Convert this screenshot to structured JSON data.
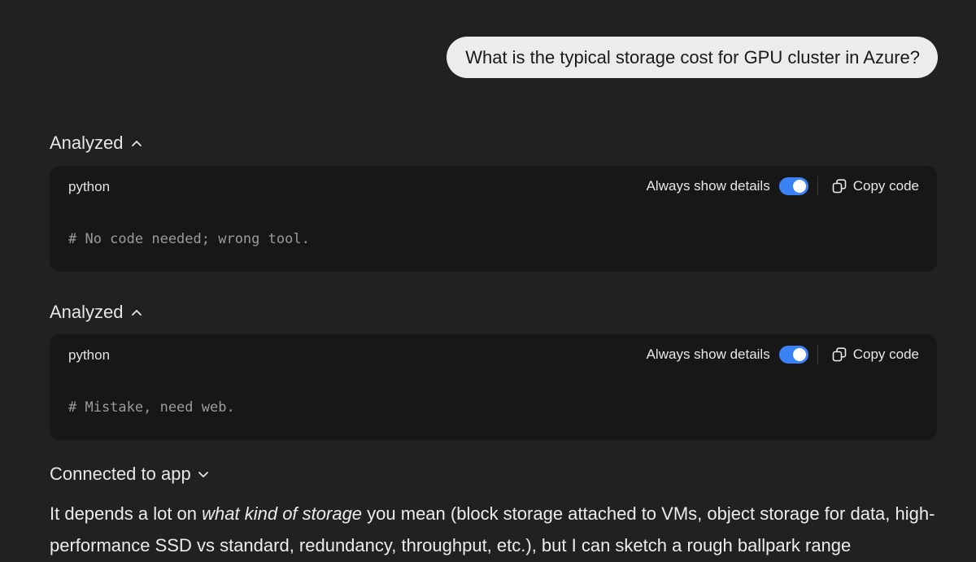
{
  "user_message": "What is the typical storage cost for GPU cluster in Azure?",
  "tool_calls": [
    {
      "status": "Analyzed",
      "language": "python",
      "toggle_label": "Always show details",
      "toggle_on": true,
      "copy_label": "Copy code",
      "code": "# No code needed; wrong tool."
    },
    {
      "status": "Analyzed",
      "language": "python",
      "toggle_label": "Always show details",
      "toggle_on": true,
      "copy_label": "Copy code",
      "code": "# Mistake, need web."
    }
  ],
  "connected": {
    "label": "Connected to app"
  },
  "answer": {
    "prefix": "It depends a lot on ",
    "emphasis": "what kind of storage",
    "suffix": " you mean (block storage attached to VMs, object storage for data, high-performance SSD vs standard, redundancy, throughput, etc.), but I can sketch a rough ballpark range"
  },
  "colors": {
    "background": "#212121",
    "code_bg": "#171717",
    "bubble_bg": "#ececec",
    "toggle_accent": "#3b82f6"
  }
}
